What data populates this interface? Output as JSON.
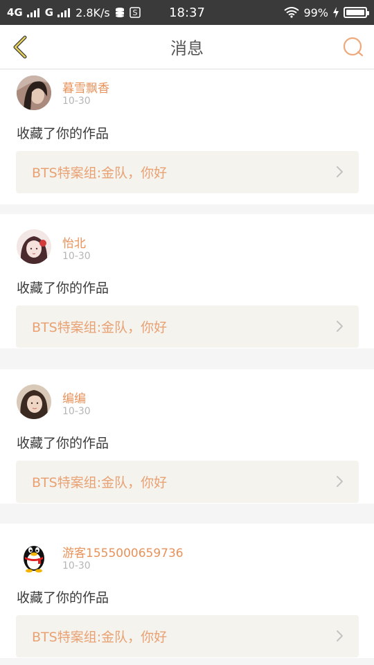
{
  "status_bar": {
    "network": "4G",
    "network2": "G",
    "speed": "2.8K/s",
    "time": "18:37",
    "battery": "99%",
    "battery_level": 0.99
  },
  "nav": {
    "title": "消息",
    "back_icon": "chevron-left-icon",
    "search_icon": "search-icon"
  },
  "colors": {
    "accent": "#e8925a",
    "link_text": "#e9a173",
    "back_icon": "#d8c44a"
  },
  "messages": [
    {
      "user": "暮雪飘香",
      "date": "10-30",
      "action": "收藏了你的作品",
      "work": "BTS特案组:金队，你好",
      "avatar": "photo-avatar-dark-hair"
    },
    {
      "user": "怡北",
      "date": "10-30",
      "action": "收藏了你的作品",
      "work": "BTS特案组:金队，你好",
      "avatar": "illustrated-avatar-girl-flower"
    },
    {
      "user": "编编",
      "date": "10-30",
      "action": "收藏了你的作品",
      "work": "BTS特案组:金队，你好",
      "avatar": "photo-avatar-girl"
    },
    {
      "user": "游客1555000659736",
      "date": "10-30",
      "action": "收藏了你的作品",
      "work": "BTS特案组:金队，你好",
      "avatar": "qq-penguin-avatar"
    }
  ]
}
